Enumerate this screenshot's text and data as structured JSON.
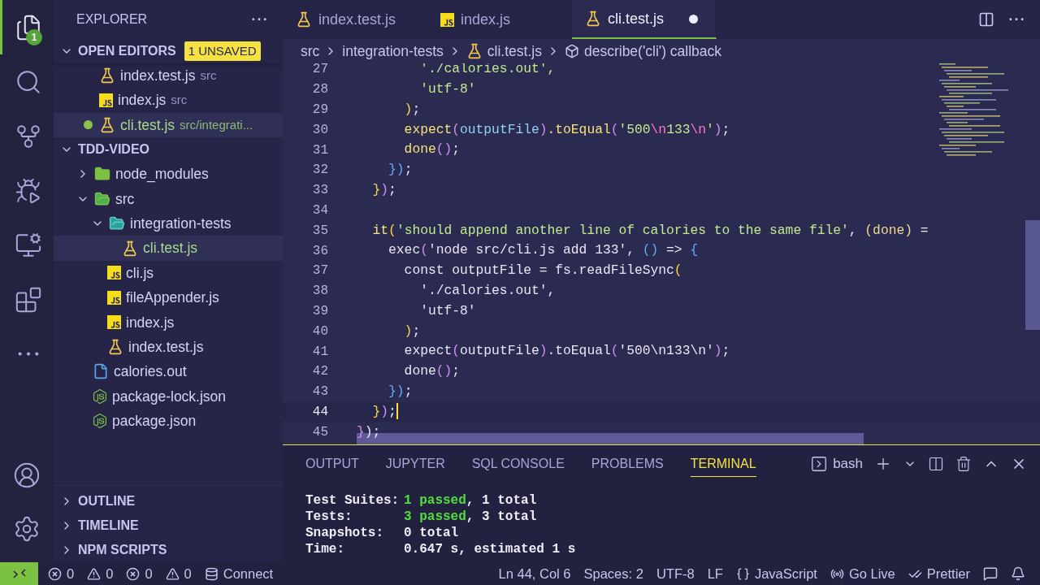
{
  "activity_bar": {
    "items": [
      {
        "kind": "files",
        "selected": true,
        "badge": "1"
      },
      {
        "kind": "search",
        "selected": false
      },
      {
        "kind": "source-control",
        "selected": false
      },
      {
        "kind": "run-debug",
        "selected": false
      },
      {
        "kind": "remote",
        "selected": false
      },
      {
        "kind": "extensions",
        "selected": false
      },
      {
        "kind": "more",
        "selected": false
      }
    ],
    "bottom": [
      {
        "kind": "account"
      },
      {
        "kind": "settings"
      }
    ]
  },
  "sidebar": {
    "title": "EXPLORER",
    "open_editors": {
      "title": "OPEN EDITORS",
      "expanded": true,
      "badge": "1 UNSAVED",
      "items": [
        {
          "name": "index.test.js",
          "description": "src",
          "kind": "test",
          "unsaved": false,
          "selected": false
        },
        {
          "name": "index.js",
          "description": "src",
          "kind": "js",
          "unsaved": false,
          "selected": false
        },
        {
          "name": "cli.test.js",
          "description": "src/integrati...",
          "kind": "test",
          "unsaved": true,
          "selected": true
        }
      ]
    },
    "project": {
      "title": "TDD-VIDEO",
      "expanded": true,
      "items": [
        {
          "name": "node_modules",
          "kind": "folder-node",
          "expanded": false,
          "selected": false,
          "modified": false
        },
        {
          "name": "src",
          "kind": "folder-src",
          "expanded": true,
          "selected": false,
          "modified": false,
          "children": [
            {
              "name": "integration-tests",
              "kind": "folder-test",
              "expanded": true,
              "selected": false,
              "modified": false,
              "children": [
                {
                  "name": "cli.test.js",
                  "kind": "test",
                  "selected": true,
                  "modified": true
                }
              ]
            },
            {
              "name": "cli.js",
              "kind": "js",
              "selected": false,
              "modified": false
            },
            {
              "name": "fileAppender.js",
              "kind": "js",
              "selected": false,
              "modified": false
            },
            {
              "name": "index.js",
              "kind": "js",
              "selected": false,
              "modified": false
            },
            {
              "name": "index.test.js",
              "kind": "test",
              "selected": false,
              "modified": false
            }
          ]
        },
        {
          "name": "calories.out",
          "kind": "file",
          "selected": false,
          "modified": false
        },
        {
          "name": "package-lock.json",
          "kind": "npm",
          "selected": false,
          "modified": false
        },
        {
          "name": "package.json",
          "kind": "npm",
          "selected": false,
          "modified": false
        }
      ]
    },
    "sections": [
      {
        "title": "OUTLINE",
        "expanded": false
      },
      {
        "title": "TIMELINE",
        "expanded": false
      },
      {
        "title": "NPM SCRIPTS",
        "expanded": false
      }
    ]
  },
  "tabs": [
    {
      "label": "index.test.js",
      "kind": "test",
      "selected": false,
      "unsaved": false
    },
    {
      "label": "index.js",
      "kind": "js",
      "selected": false,
      "unsaved": false
    },
    {
      "label": "cli.test.js",
      "kind": "test",
      "selected": true,
      "unsaved": true
    }
  ],
  "breadcrumbs": [
    {
      "label": "src",
      "kind": "folder"
    },
    {
      "label": "integration-tests",
      "kind": "folder"
    },
    {
      "label": "cli.test.js",
      "kind": "test"
    },
    {
      "label": "describe('cli') callback",
      "kind": "symbol"
    }
  ],
  "code": [
    {
      "number": "27",
      "current": false,
      "tokens": [
        {
          "text": "        './calories.out',",
          "kind": "string"
        }
      ]
    },
    {
      "number": "28",
      "current": false,
      "tokens": [
        {
          "text": "        'utf-8'",
          "kind": "string"
        }
      ]
    },
    {
      "number": "29",
      "current": false,
      "tokens": [
        {
          "text": "      )",
          "kind": "bracket1"
        },
        {
          "text": ";",
          "kind": "plain"
        }
      ]
    },
    {
      "number": "30",
      "current": false,
      "tokens": [
        {
          "text": "      expect",
          "kind": "func"
        },
        {
          "text": "(",
          "kind": "bracket2"
        },
        {
          "text": "outputFile",
          "kind": "var"
        },
        {
          "text": ")",
          "kind": "bracket2"
        },
        {
          "text": ".toEqual",
          "kind": "func"
        },
        {
          "text": "(",
          "kind": "bracket2"
        },
        {
          "text": "'500",
          "kind": "string"
        },
        {
          "text": "\\n",
          "kind": "escape"
        },
        {
          "text": "133",
          "kind": "string"
        },
        {
          "text": "\\n",
          "kind": "escape"
        },
        {
          "text": "'",
          "kind": "string"
        },
        {
          "text": ")",
          "kind": "bracket2"
        },
        {
          "text": ";",
          "kind": "plain"
        }
      ]
    },
    {
      "number": "31",
      "current": false,
      "tokens": [
        {
          "text": "      done",
          "kind": "func"
        },
        {
          "text": "()",
          "kind": "bracket2"
        },
        {
          "text": ";",
          "kind": "plain"
        }
      ]
    },
    {
      "number": "32",
      "current": false,
      "tokens": [
        {
          "text": "    })",
          "kind": "bracket3"
        },
        {
          "text": ";",
          "kind": "plain"
        }
      ]
    },
    {
      "number": "33",
      "current": false,
      "tokens": [
        {
          "text": "  }",
          "kind": "bracket1"
        },
        {
          "text": ")",
          "kind": "bracket2"
        },
        {
          "text": ";",
          "kind": "plain"
        }
      ]
    },
    {
      "number": "34",
      "current": false
    },
    {
      "number": "35",
      "current": false,
      "tokens": [
        {
          "text": "  it",
          "kind": "func"
        },
        {
          "text": "(",
          "kind": "bracket1"
        },
        {
          "text": "'should append another line of calories to the same file'",
          "kind": "string"
        },
        {
          "text": ", ",
          "kind": "plain"
        },
        {
          "text": "(done)",
          "kind": "param"
        },
        {
          "text": " =",
          "kind": "plain"
        }
      ]
    },
    {
      "number": "36",
      "current": false,
      "tokens": [
        {
          "text": "    exec",
          "kind": "plain"
        },
        {
          "text": "(",
          "kind": "bracket2"
        },
        {
          "text": "'node src/cli.js add 133'",
          "kind": "plain"
        },
        {
          "text": ", ",
          "kind": "plain"
        },
        {
          "text": "()",
          "kind": "bracket3"
        },
        {
          "text": " => ",
          "kind": "plain"
        },
        {
          "text": "{",
          "kind": "bracket3"
        }
      ]
    },
    {
      "number": "37",
      "current": false,
      "tokens": [
        {
          "text": "      const outputFile = fs.readFileSync",
          "kind": "plain"
        },
        {
          "text": "(",
          "kind": "bracket1"
        }
      ]
    },
    {
      "number": "38",
      "current": false,
      "tokens": [
        {
          "text": "        './calories.out',",
          "kind": "plain"
        }
      ]
    },
    {
      "number": "39",
      "current": false,
      "tokens": [
        {
          "text": "        'utf-8'",
          "kind": "plain"
        }
      ]
    },
    {
      "number": "40",
      "current": false,
      "tokens": [
        {
          "text": "      )",
          "kind": "bracket1"
        },
        {
          "text": ";",
          "kind": "plain"
        }
      ]
    },
    {
      "number": "41",
      "current": false,
      "tokens": [
        {
          "text": "      expect",
          "kind": "plain"
        },
        {
          "text": "(",
          "kind": "bracket2"
        },
        {
          "text": "outputFile",
          "kind": "plain"
        },
        {
          "text": ")",
          "kind": "bracket2"
        },
        {
          "text": ".toEqual",
          "kind": "plain"
        },
        {
          "text": "(",
          "kind": "bracket2"
        },
        {
          "text": "'500\\n133\\n'",
          "kind": "plain"
        },
        {
          "text": ")",
          "kind": "bracket2"
        },
        {
          "text": ";",
          "kind": "plain"
        }
      ]
    },
    {
      "number": "42",
      "current": false,
      "tokens": [
        {
          "text": "      done",
          "kind": "plain"
        },
        {
          "text": "()",
          "kind": "bracket2"
        },
        {
          "text": ";",
          "kind": "plain"
        }
      ]
    },
    {
      "number": "43",
      "current": false,
      "tokens": [
        {
          "text": "    })",
          "kind": "bracket3"
        },
        {
          "text": ";",
          "kind": "plain"
        }
      ]
    },
    {
      "number": "44",
      "current": true,
      "tokens": [
        {
          "text": "  }",
          "kind": "bracket1"
        },
        {
          "text": ")",
          "kind": "bracket2"
        },
        {
          "text": ";",
          "kind": "plain"
        }
      ]
    },
    {
      "number": "45",
      "current": false,
      "tokens": [
        {
          "text": "}",
          "kind": "bracket2"
        },
        {
          "text": ");",
          "kind": "plain"
        }
      ]
    }
  ],
  "panel": {
    "tabs": [
      {
        "label": "OUTPUT",
        "selected": false
      },
      {
        "label": "JUPYTER",
        "selected": false
      },
      {
        "label": "SQL CONSOLE",
        "selected": false
      },
      {
        "label": "PROBLEMS",
        "selected": false
      },
      {
        "label": "TERMINAL",
        "selected": true
      }
    ],
    "shell": "bash",
    "terminal": [
      {
        "label": "Test Suites:",
        "parts": [
          {
            "text": "1 passed",
            "kind": "pass"
          },
          {
            "text": ", 1 total",
            "kind": "plain"
          }
        ]
      },
      {
        "label": "Tests:",
        "parts": [
          {
            "text": "3 passed",
            "kind": "pass"
          },
          {
            "text": ", 3 total",
            "kind": "plain"
          }
        ]
      },
      {
        "label": "Snapshots:",
        "parts": [
          {
            "text": "0 total",
            "kind": "plain"
          }
        ]
      },
      {
        "label": "Time:",
        "parts": [
          {
            "text": "0.647 s, estimated 1 s",
            "kind": "plain"
          }
        ]
      }
    ]
  },
  "status_bar": {
    "left": [
      {
        "kind": "errors",
        "text": "0"
      },
      {
        "kind": "warnings",
        "text": "0"
      },
      {
        "kind": "errors",
        "text": "0"
      },
      {
        "kind": "warnings",
        "text": "0"
      },
      {
        "kind": "database",
        "text": "Connect"
      }
    ],
    "right": [
      {
        "kind": "text",
        "text": "Ln 44, Col 6"
      },
      {
        "kind": "text",
        "text": "Spaces: 2"
      },
      {
        "kind": "text",
        "text": "UTF-8"
      },
      {
        "kind": "text",
        "text": "LF"
      },
      {
        "kind": "language",
        "text": "JavaScript"
      },
      {
        "kind": "live",
        "text": "Go Live"
      },
      {
        "kind": "prettier",
        "text": "Prettier"
      },
      {
        "kind": "feedback"
      },
      {
        "kind": "bell"
      }
    ]
  }
}
